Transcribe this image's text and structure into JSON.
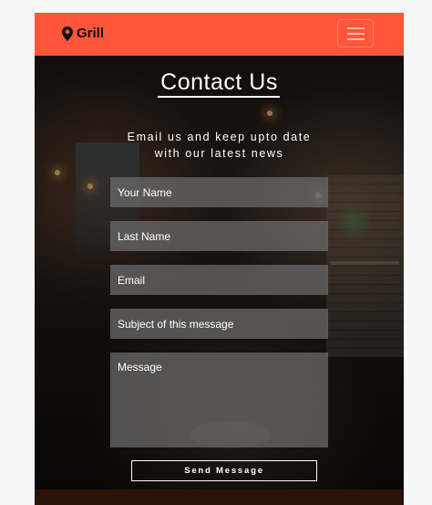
{
  "navbar": {
    "brand_label": "Grill",
    "brand_icon": "map-pin-icon",
    "menu_icon": "hamburger-menu-icon",
    "accent_color": "#ff5538"
  },
  "contact": {
    "title": "Contact Us",
    "subtitle_line1": "Email us and keep upto date",
    "subtitle_line2": "with our latest news",
    "fields": {
      "your_name_placeholder": "Your Name",
      "last_name_placeholder": "Last Name",
      "email_placeholder": "Email",
      "subject_placeholder": "Subject of this message",
      "message_placeholder": "Message"
    },
    "send_label": "Send Message"
  }
}
